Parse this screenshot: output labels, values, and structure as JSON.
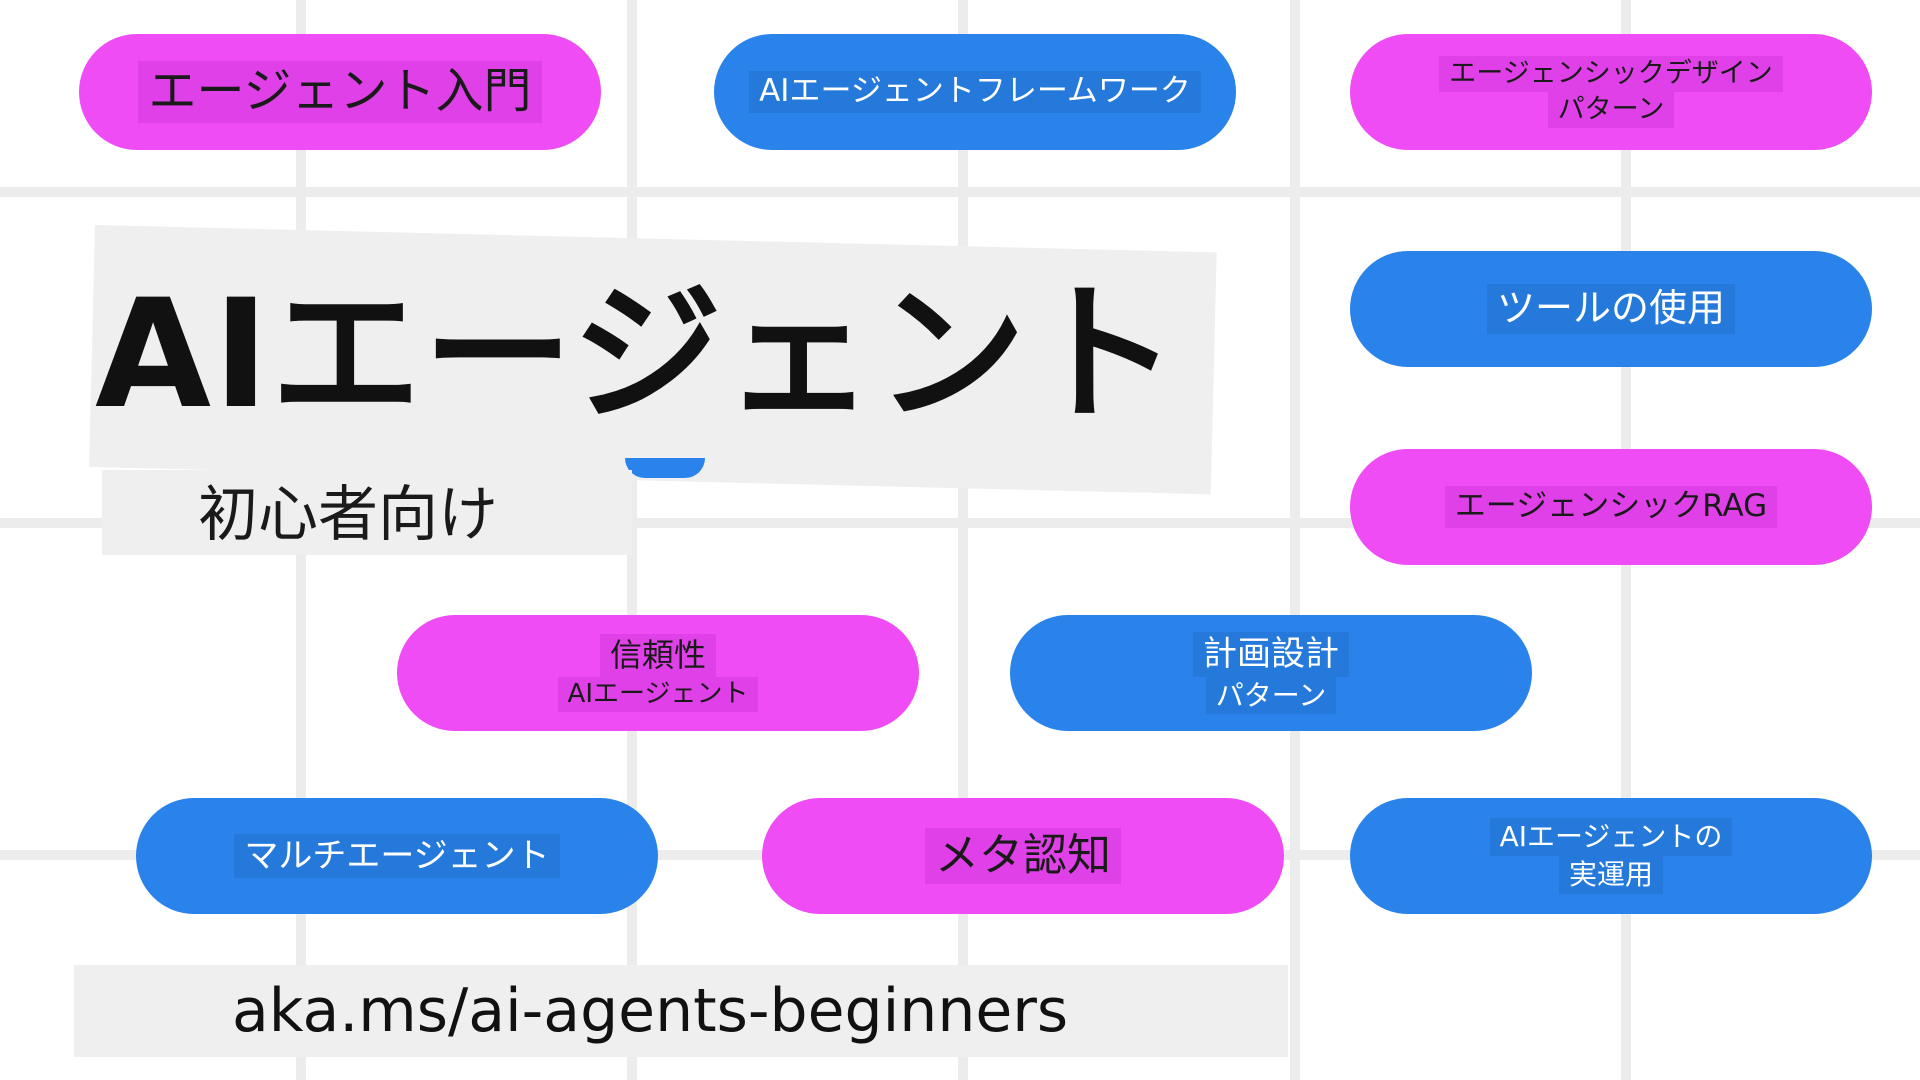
{
  "title": "AIエージェント",
  "subtitle": "初心者向け",
  "url": "aka.ms/ai-agents-beginners",
  "colors": {
    "pink": "#ef4cf5",
    "blue": "#2983ea",
    "grid": "#ececec"
  },
  "lessons": [
    {
      "lines": [
        "エージェント入門"
      ],
      "color": "pink"
    },
    {
      "lines": [
        "AIエージェントフレームワーク"
      ],
      "color": "blue"
    },
    {
      "lines": [
        "エージェンシックデザイン",
        "パターン"
      ],
      "color": "pink"
    },
    {
      "lines": [
        "ツールの使用"
      ],
      "color": "blue"
    },
    {
      "lines": [
        "エージェンシックRAG"
      ],
      "color": "pink"
    },
    {
      "lines": [
        "信頼性",
        "AIエージェント"
      ],
      "color": "pink"
    },
    {
      "lines": [
        "計画設計",
        "パターン"
      ],
      "color": "blue"
    },
    {
      "lines": [
        "マルチエージェント"
      ],
      "color": "blue"
    },
    {
      "lines": [
        "メタ認知"
      ],
      "color": "pink"
    },
    {
      "lines": [
        "AIエージェントの",
        "実運用"
      ],
      "color": "blue"
    }
  ]
}
